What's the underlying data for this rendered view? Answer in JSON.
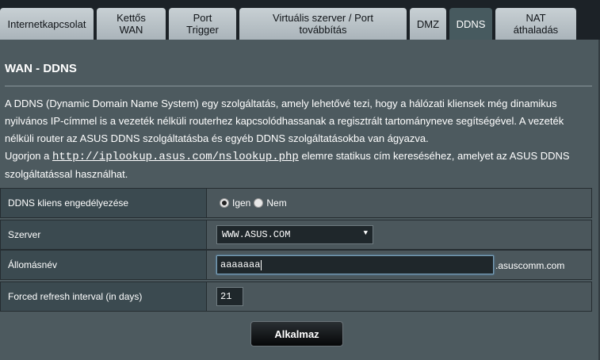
{
  "tabs": [
    {
      "label": "Internetkapcsolat",
      "active": false
    },
    {
      "label": "Kettős\nWAN",
      "active": false
    },
    {
      "label": "Port\nTrigger",
      "active": false
    },
    {
      "label": "Virtuális szerver / Port\ntovábbítás",
      "active": false
    },
    {
      "label": "DMZ",
      "active": false
    },
    {
      "label": "DDNS",
      "active": true
    },
    {
      "label": "NAT\náthaladás",
      "active": false
    }
  ],
  "page": {
    "title": "WAN - DDNS",
    "description_1": "A DDNS (Dynamic Domain Name System) egy szolgáltatás, amely lehetővé tezi, hogy a hálózati kliensek még dinamikus nyilvános IP-címmel is a vezeték nélküli routerhez kapcsolódhassanak a regisztrált tartományneve segítségével. A vezeték nélküli router az ASUS DDNS szolgáltatásba és egyéb DDNS szolgáltatásokba van ágyazva.",
    "description_2_prefix": "Ugorjon a ",
    "description_2_link": "http://iplookup.asus.com/nslookup.php",
    "description_2_suffix": " elemre statikus cím kereséséhez, amelyet az ASUS DDNS szolgáltatással használhat."
  },
  "form": {
    "enable": {
      "label": "DDNS kliens engedélyezése",
      "options": [
        "Igen",
        "Nem"
      ],
      "selected": "Igen"
    },
    "server": {
      "label": "Szerver",
      "value": "WWW.ASUS.COM"
    },
    "hostname": {
      "label": "Állomásnév",
      "value": "aaaaaaa",
      "suffix": ".asuscomm.com"
    },
    "refresh": {
      "label": "Forced refresh interval (in days)",
      "value": "21"
    }
  },
  "apply_button": "Alkalmaz",
  "colors": {
    "panel": "#4d5a5f",
    "label_cell": "#3b4a50",
    "active_tab": "#475a5f",
    "inactive_tab": "#b4bec3"
  }
}
